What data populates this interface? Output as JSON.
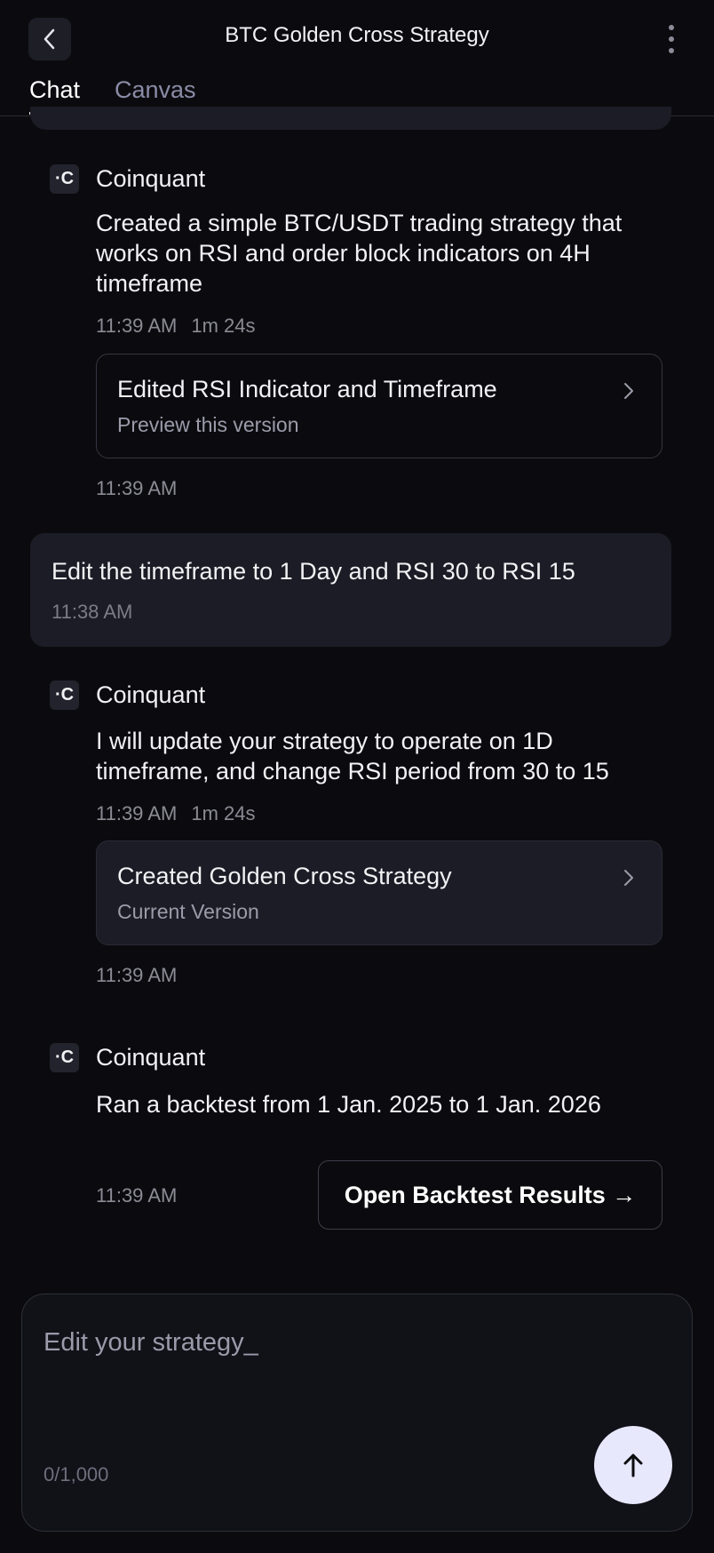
{
  "header": {
    "title": "BTC Golden Cross Strategy"
  },
  "tabs": [
    {
      "label": "Chat"
    },
    {
      "label": "Canvas"
    }
  ],
  "messages": {
    "bot1": {
      "name": "Coinquant",
      "text": "Created a simple BTC/USDT trading strategy that works on RSI and order block indicators on 4H timeframe",
      "time": "11:39 AM",
      "duration": "1m 24s",
      "card": {
        "title": "Edited RSI Indicator and Timeframe",
        "subtitle": "Preview this version"
      },
      "footer_time": "11:39 AM"
    },
    "user1": {
      "text": "Edit the timeframe to 1 Day and RSI 30 to RSI 15",
      "time": "11:38 AM"
    },
    "bot2": {
      "name": "Coinquant",
      "text": "I will update your strategy to operate on 1D timeframe, and change RSI period from 30 to 15",
      "time": "11:39 AM",
      "duration": "1m 24s",
      "card": {
        "title": "Created Golden Cross Strategy",
        "subtitle": "Current Version"
      },
      "footer_time": "11:39 AM"
    },
    "bot3": {
      "name": "Coinquant",
      "text": "Ran a backtest from 1 Jan. 2025 to 1 Jan. 2026",
      "time": "11:39 AM",
      "button": "Open Backtest Results →"
    }
  },
  "composer": {
    "placeholder": "Edit your strategy_",
    "count": "0/1,000"
  },
  "logo_glyph": "·C"
}
